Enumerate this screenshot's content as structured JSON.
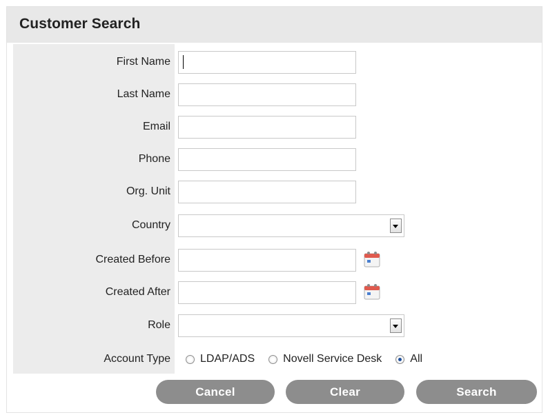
{
  "panel": {
    "title": "Customer Search"
  },
  "form": {
    "first_name": {
      "label": "First Name",
      "value": ""
    },
    "last_name": {
      "label": "Last Name",
      "value": ""
    },
    "email": {
      "label": "Email",
      "value": ""
    },
    "phone": {
      "label": "Phone",
      "value": ""
    },
    "org_unit": {
      "label": "Org. Unit",
      "value": ""
    },
    "country": {
      "label": "Country",
      "value": ""
    },
    "created_before": {
      "label": "Created Before",
      "value": ""
    },
    "created_after": {
      "label": "Created After",
      "value": ""
    },
    "role": {
      "label": "Role",
      "value": ""
    },
    "account_type": {
      "label": "Account Type",
      "options": [
        "LDAP/ADS",
        "Novell Service Desk",
        "All"
      ],
      "selected": "All"
    }
  },
  "buttons": {
    "cancel": "Cancel",
    "clear": "Clear",
    "search": "Search"
  },
  "colors": {
    "header_bg": "#e8e8e8",
    "label_bg": "#ececec",
    "button_bg": "#8d8d8d",
    "radio_dot": "#1d4f9c"
  }
}
